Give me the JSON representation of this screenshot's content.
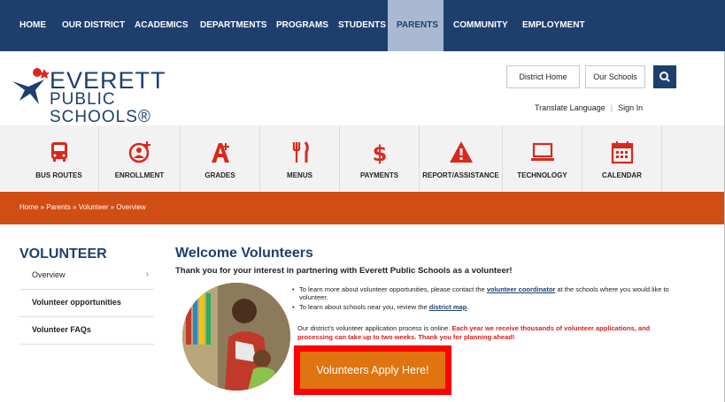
{
  "nav": {
    "items": [
      {
        "label": "HOME"
      },
      {
        "label": "OUR DISTRICT"
      },
      {
        "label": "ACADEMICS"
      },
      {
        "label": "DEPARTMENTS"
      },
      {
        "label": "PROGRAMS"
      },
      {
        "label": "STUDENTS"
      },
      {
        "label": "PARENTS",
        "active": true
      },
      {
        "label": "COMMUNITY"
      },
      {
        "label": "EMPLOYMENT"
      }
    ]
  },
  "header": {
    "logo_line1": "EVERETT",
    "logo_line2": "PUBLIC SCHOOLS®",
    "district_home": "District Home",
    "our_schools": "Our Schools",
    "search_icon": "search-icon",
    "translate": "Translate Language",
    "sep": "|",
    "sign_in": "Sign In"
  },
  "iconbar": {
    "items": [
      {
        "label": "BUS ROUTES",
        "icon": "bus-icon"
      },
      {
        "label": "ENROLLMENT",
        "icon": "enrollment-icon"
      },
      {
        "label": "GRADES",
        "icon": "grades-icon"
      },
      {
        "label": "MENUS",
        "icon": "menus-icon"
      },
      {
        "label": "PAYMENTS",
        "icon": "payments-icon"
      },
      {
        "label": "REPORT/ASSISTANCE",
        "icon": "warning-icon"
      },
      {
        "label": "TECHNOLOGY",
        "icon": "laptop-icon"
      },
      {
        "label": "CALENDAR",
        "icon": "calendar-icon"
      }
    ]
  },
  "breadcrumb": {
    "text": "Home  »  Parents  »  Volunteer  »  Overview"
  },
  "sidebar": {
    "title": "VOLUNTEER",
    "items": [
      {
        "label": "Overview",
        "chevron": "›"
      },
      {
        "label": "Volunteer opportunities"
      },
      {
        "label": "Volunteer FAQs"
      }
    ]
  },
  "main": {
    "title": "Welcome Volunteers",
    "intro": "Thank you for your interest in partnering with Everett Public Schools as a volunteer!",
    "bullet1_pre": "To learn more about volunteer opportunities, please contact the ",
    "bullet1_link": "volunteer coordinator",
    "bullet1_post": " at the schools where you would like to volunteer.",
    "bullet2_pre": "To learn about schools near you, review the ",
    "bullet2_link": "district map",
    "bullet2_post": ".",
    "online_pre": "Our district's volunteer application process is online. ",
    "online_red": "Each year we receive thousands of volunteer applications, and processing can take up to two weeks. Thank you for planning ahead!",
    "apply_button": "Volunteers Apply Here!"
  },
  "colors": {
    "navy": "#1e3f6e",
    "orange_bar": "#d14d16",
    "apply_orange": "#e07410",
    "highlight_red": "#ff0000",
    "icon_red": "#d9291c"
  }
}
